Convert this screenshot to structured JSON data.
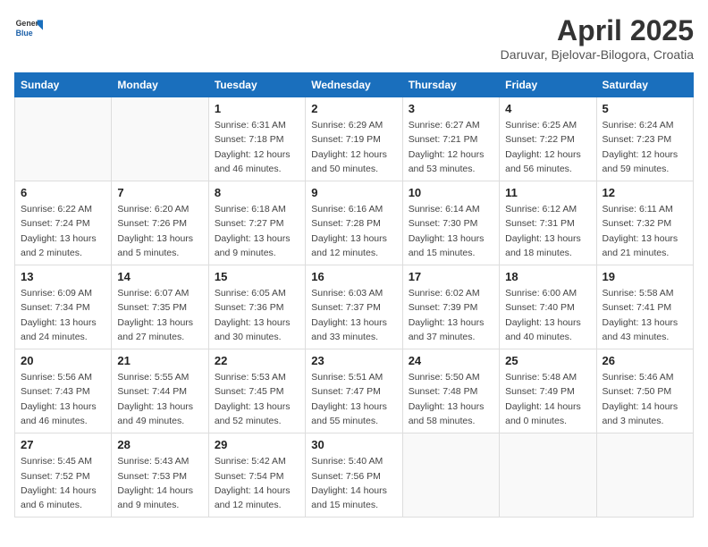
{
  "header": {
    "logo_general": "General",
    "logo_blue": "Blue",
    "month_title": "April 2025",
    "location": "Daruvar, Bjelovar-Bilogora, Croatia"
  },
  "weekdays": [
    "Sunday",
    "Monday",
    "Tuesday",
    "Wednesday",
    "Thursday",
    "Friday",
    "Saturday"
  ],
  "weeks": [
    [
      {
        "day": "",
        "info": ""
      },
      {
        "day": "",
        "info": ""
      },
      {
        "day": "1",
        "info": "Sunrise: 6:31 AM\nSunset: 7:18 PM\nDaylight: 12 hours\nand 46 minutes."
      },
      {
        "day": "2",
        "info": "Sunrise: 6:29 AM\nSunset: 7:19 PM\nDaylight: 12 hours\nand 50 minutes."
      },
      {
        "day": "3",
        "info": "Sunrise: 6:27 AM\nSunset: 7:21 PM\nDaylight: 12 hours\nand 53 minutes."
      },
      {
        "day": "4",
        "info": "Sunrise: 6:25 AM\nSunset: 7:22 PM\nDaylight: 12 hours\nand 56 minutes."
      },
      {
        "day": "5",
        "info": "Sunrise: 6:24 AM\nSunset: 7:23 PM\nDaylight: 12 hours\nand 59 minutes."
      }
    ],
    [
      {
        "day": "6",
        "info": "Sunrise: 6:22 AM\nSunset: 7:24 PM\nDaylight: 13 hours\nand 2 minutes."
      },
      {
        "day": "7",
        "info": "Sunrise: 6:20 AM\nSunset: 7:26 PM\nDaylight: 13 hours\nand 5 minutes."
      },
      {
        "day": "8",
        "info": "Sunrise: 6:18 AM\nSunset: 7:27 PM\nDaylight: 13 hours\nand 9 minutes."
      },
      {
        "day": "9",
        "info": "Sunrise: 6:16 AM\nSunset: 7:28 PM\nDaylight: 13 hours\nand 12 minutes."
      },
      {
        "day": "10",
        "info": "Sunrise: 6:14 AM\nSunset: 7:30 PM\nDaylight: 13 hours\nand 15 minutes."
      },
      {
        "day": "11",
        "info": "Sunrise: 6:12 AM\nSunset: 7:31 PM\nDaylight: 13 hours\nand 18 minutes."
      },
      {
        "day": "12",
        "info": "Sunrise: 6:11 AM\nSunset: 7:32 PM\nDaylight: 13 hours\nand 21 minutes."
      }
    ],
    [
      {
        "day": "13",
        "info": "Sunrise: 6:09 AM\nSunset: 7:34 PM\nDaylight: 13 hours\nand 24 minutes."
      },
      {
        "day": "14",
        "info": "Sunrise: 6:07 AM\nSunset: 7:35 PM\nDaylight: 13 hours\nand 27 minutes."
      },
      {
        "day": "15",
        "info": "Sunrise: 6:05 AM\nSunset: 7:36 PM\nDaylight: 13 hours\nand 30 minutes."
      },
      {
        "day": "16",
        "info": "Sunrise: 6:03 AM\nSunset: 7:37 PM\nDaylight: 13 hours\nand 33 minutes."
      },
      {
        "day": "17",
        "info": "Sunrise: 6:02 AM\nSunset: 7:39 PM\nDaylight: 13 hours\nand 37 minutes."
      },
      {
        "day": "18",
        "info": "Sunrise: 6:00 AM\nSunset: 7:40 PM\nDaylight: 13 hours\nand 40 minutes."
      },
      {
        "day": "19",
        "info": "Sunrise: 5:58 AM\nSunset: 7:41 PM\nDaylight: 13 hours\nand 43 minutes."
      }
    ],
    [
      {
        "day": "20",
        "info": "Sunrise: 5:56 AM\nSunset: 7:43 PM\nDaylight: 13 hours\nand 46 minutes."
      },
      {
        "day": "21",
        "info": "Sunrise: 5:55 AM\nSunset: 7:44 PM\nDaylight: 13 hours\nand 49 minutes."
      },
      {
        "day": "22",
        "info": "Sunrise: 5:53 AM\nSunset: 7:45 PM\nDaylight: 13 hours\nand 52 minutes."
      },
      {
        "day": "23",
        "info": "Sunrise: 5:51 AM\nSunset: 7:47 PM\nDaylight: 13 hours\nand 55 minutes."
      },
      {
        "day": "24",
        "info": "Sunrise: 5:50 AM\nSunset: 7:48 PM\nDaylight: 13 hours\nand 58 minutes."
      },
      {
        "day": "25",
        "info": "Sunrise: 5:48 AM\nSunset: 7:49 PM\nDaylight: 14 hours\nand 0 minutes."
      },
      {
        "day": "26",
        "info": "Sunrise: 5:46 AM\nSunset: 7:50 PM\nDaylight: 14 hours\nand 3 minutes."
      }
    ],
    [
      {
        "day": "27",
        "info": "Sunrise: 5:45 AM\nSunset: 7:52 PM\nDaylight: 14 hours\nand 6 minutes."
      },
      {
        "day": "28",
        "info": "Sunrise: 5:43 AM\nSunset: 7:53 PM\nDaylight: 14 hours\nand 9 minutes."
      },
      {
        "day": "29",
        "info": "Sunrise: 5:42 AM\nSunset: 7:54 PM\nDaylight: 14 hours\nand 12 minutes."
      },
      {
        "day": "30",
        "info": "Sunrise: 5:40 AM\nSunset: 7:56 PM\nDaylight: 14 hours\nand 15 minutes."
      },
      {
        "day": "",
        "info": ""
      },
      {
        "day": "",
        "info": ""
      },
      {
        "day": "",
        "info": ""
      }
    ]
  ]
}
